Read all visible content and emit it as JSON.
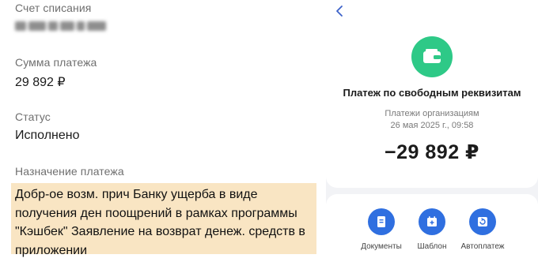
{
  "left": {
    "account": {
      "label": "Счет списания"
    },
    "amount": {
      "label": "Сумма платежа",
      "value": "29 892 ₽"
    },
    "status": {
      "label": "Статус",
      "value": "Исполнено"
    },
    "purpose": {
      "label": "Назначение платежа",
      "lines": [
        "Добр-ое возм. прич Банку ущерба в виде",
        "получения ден поощрений в рамках программы",
        "\"Кэшбек\" Заявление на возврат денеж. средств в",
        "приложении"
      ]
    }
  },
  "right": {
    "back_icon": "chevron-left-icon",
    "header_icon": "wallet-icon",
    "title": "Платеж по свободным реквизитам",
    "org": "Платежи организациям",
    "datetime": "26 мая 2025 г., 09:58",
    "amount": "−29 892 ₽",
    "actions": [
      {
        "label": "Документы",
        "icon": "document-icon"
      },
      {
        "label": "Шаблон",
        "icon": "template-icon"
      },
      {
        "label": "Автоплатеж",
        "icon": "autopay-icon"
      }
    ]
  },
  "colors": {
    "accent_green": "#2ec987",
    "accent_blue": "#2f6fe0",
    "highlight": "#f9e5c3",
    "back_blue": "#3d63c9"
  }
}
